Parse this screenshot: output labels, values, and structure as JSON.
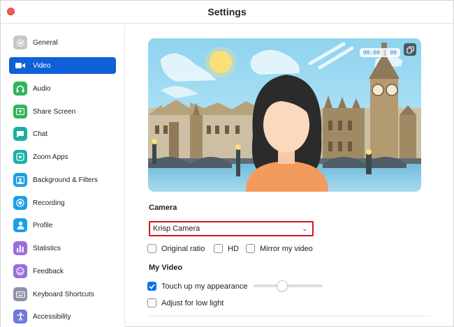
{
  "window": {
    "title": "Settings"
  },
  "sidebar": {
    "items": [
      {
        "label": "General",
        "icon": "gear-icon",
        "color": "#c7c7c7",
        "active": false
      },
      {
        "label": "Video",
        "icon": "video-camera-icon",
        "color": "#0e61d6",
        "active": true
      },
      {
        "label": "Audio",
        "icon": "headphones-icon",
        "color": "#2fb45a",
        "active": false
      },
      {
        "label": "Share Screen",
        "icon": "share-screen-icon",
        "color": "#2fb45a",
        "active": false
      },
      {
        "label": "Chat",
        "icon": "chat-bubble-icon",
        "color": "#1ab0a5",
        "active": false
      },
      {
        "label": "Zoom Apps",
        "icon": "apps-icon",
        "color": "#1ab0a5",
        "active": false
      },
      {
        "label": "Background & Filters",
        "icon": "background-icon",
        "color": "#1aa0e8",
        "active": false
      },
      {
        "label": "Recording",
        "icon": "record-icon",
        "color": "#1aa0e8",
        "active": false
      },
      {
        "label": "Profile",
        "icon": "person-icon",
        "color": "#1aa0e8",
        "active": false
      },
      {
        "label": "Statistics",
        "icon": "bar-chart-icon",
        "color": "#9a6cdc",
        "active": false
      },
      {
        "label": "Feedback",
        "icon": "smiley-icon",
        "color": "#9a6cdc",
        "active": false
      },
      {
        "label": "Keyboard Shortcuts",
        "icon": "keyboard-icon",
        "color": "#8e8fa8",
        "active": false
      },
      {
        "label": "Accessibility",
        "icon": "accessibility-icon",
        "color": "#6d7ad6",
        "active": false
      }
    ]
  },
  "video": {
    "preview": {
      "timer": "00:00 | 00"
    },
    "camera": {
      "heading": "Camera",
      "selected": "Krisp Camera",
      "options": {
        "original_ratio": {
          "label": "Original ratio",
          "checked": false
        },
        "hd": {
          "label": "HD",
          "checked": false
        },
        "mirror": {
          "label": "Mirror my video",
          "checked": false
        }
      }
    },
    "my_video": {
      "heading": "My Video",
      "touch_up": {
        "label": "Touch up my appearance",
        "checked": true,
        "level": 0.4
      },
      "low_light": {
        "label": "Adjust for low light",
        "checked": false
      }
    }
  },
  "colors": {
    "accent": "#0e61d6",
    "highlight_border": "#d0161b",
    "close": "#ee5c55"
  }
}
